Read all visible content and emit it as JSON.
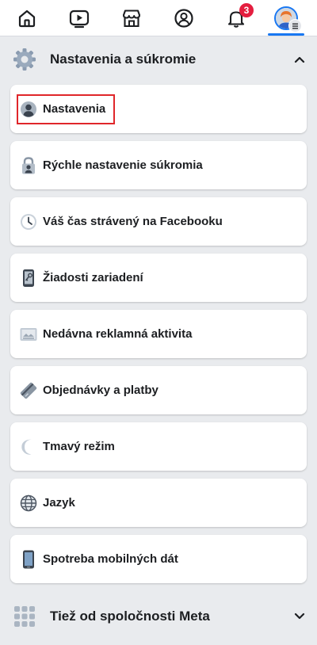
{
  "topbar": {
    "items": [
      {
        "name": "home",
        "icon": "home-icon"
      },
      {
        "name": "watch",
        "icon": "video-play-icon"
      },
      {
        "name": "marketplace",
        "icon": "storefront-icon"
      },
      {
        "name": "profile",
        "icon": "profile-circle-icon"
      },
      {
        "name": "notifications",
        "icon": "bell-icon",
        "badge": "3"
      },
      {
        "name": "menu",
        "icon": "avatar-menu-icon"
      }
    ],
    "active_color": "#1877f2",
    "badge_color": "#e41e3f"
  },
  "settings_section": {
    "title": "Nastavenia a súkromie",
    "icon": "gear-icon",
    "expanded": true,
    "items": [
      {
        "label": "Nastavenia",
        "icon": "user-circle-icon",
        "highlighted": true
      },
      {
        "label": "Rýchle nastavenie súkromia",
        "icon": "lock-user-icon"
      },
      {
        "label": "Váš čas strávený na Facebooku",
        "icon": "clock-icon"
      },
      {
        "label": "Žiadosti zariadení",
        "icon": "phone-key-icon"
      },
      {
        "label": "Nedávna reklamná aktivita",
        "icon": "ad-screen-icon"
      },
      {
        "label": "Objednávky a platby",
        "icon": "credit-card-icon"
      },
      {
        "label": "Tmavý režim",
        "icon": "moon-icon"
      },
      {
        "label": "Jazyk",
        "icon": "globe-icon"
      },
      {
        "label": "Spotreba mobilných dát",
        "icon": "mobile-phone-icon"
      }
    ]
  },
  "meta_section": {
    "title": "Tiež od spoločnosti Meta",
    "icon": "apps-grid-icon",
    "expanded": false
  },
  "highlight_color": "#e0262a"
}
